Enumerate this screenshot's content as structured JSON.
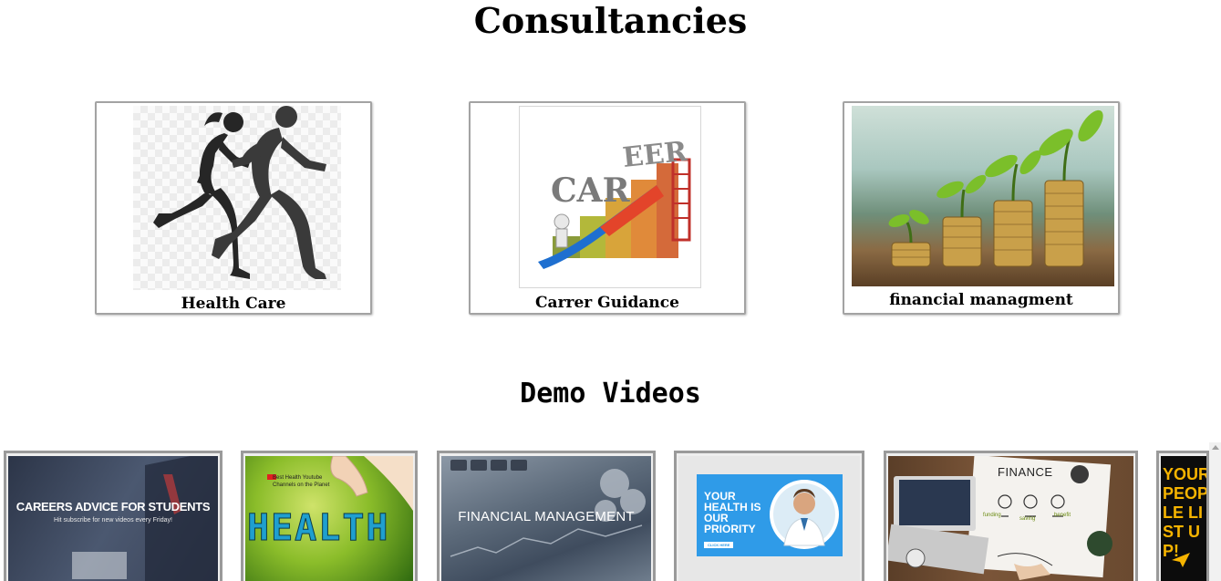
{
  "sections": {
    "consultancies_title": "Consultancies",
    "videos_title": "Demo Videos"
  },
  "cards": [
    {
      "label": "Health Care",
      "image": "runners-silhouette"
    },
    {
      "label": "Carrer Guidance",
      "image": "career-stairs"
    },
    {
      "label": "financial managment",
      "image": "coins-plants"
    }
  ],
  "videos": [
    {
      "title": "CAREERS ADVICE FOR STUDENTS",
      "subtitle": "Hit subscribe for new videos every Friday!"
    },
    {
      "title": "HEALTH",
      "subtitle": "Best Health Youtube Channels on the Planet"
    },
    {
      "title": "FINANCIAL MANAGEMENT"
    },
    {
      "title": "YOUR HEALTH IS OUR PRIORITY",
      "button": "CLICK HERE"
    },
    {
      "title": "FINANCE",
      "words": [
        "funding",
        "saving",
        "benefit"
      ]
    },
    {
      "title": "YOUR PEOPLE LIST UP!"
    }
  ],
  "colors": {
    "card_border": "#a3a3a3",
    "video_border": "#9a9a9a",
    "health_blue": "#2f9be8",
    "finance_green": "#6aa234"
  }
}
